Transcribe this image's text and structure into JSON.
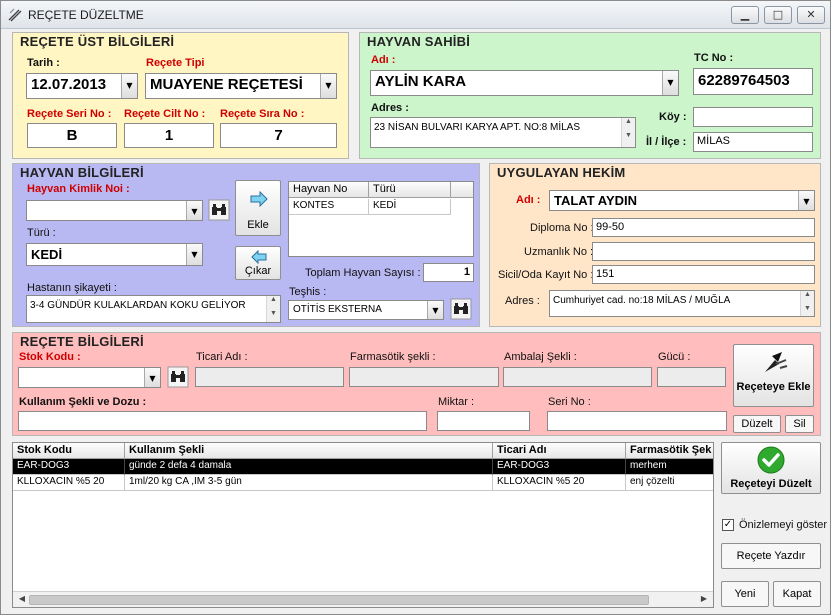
{
  "window": {
    "title": "REÇETE DÜZELTME",
    "minimize": "▁",
    "maximize": "□",
    "close": "✕"
  },
  "colors": {
    "yellow": "#fff6c4",
    "green": "#ccf5cc",
    "blue": "#b8b8f2",
    "orange": "#ffe6c9",
    "pink": "#ffbdbd",
    "label_red": "#d00000"
  },
  "recete_ust": {
    "title": "REÇETE ÜST BİLGİLERİ",
    "tarih_label": "Tarih :",
    "tarih": "12.07.2013",
    "tip_label": "Reçete Tipi",
    "tip": "MUAYENE REÇETESİ",
    "seri_label": "Reçete Seri No :",
    "seri": "B",
    "cilt_label": "Reçete Cilt No :",
    "cilt": "1",
    "sira_label": "Reçete Sıra No :",
    "sira": "7"
  },
  "hayvan_sahibi": {
    "title": "HAYVAN SAHİBİ",
    "adi_label": "Adı :",
    "adi": "AYLİN KARA",
    "tc_label": "TC No :",
    "tc": "62289764503",
    "adres_label": "Adres :",
    "adres": "23 NİSAN BULVARI KARYA APT. NO:8 MİLAS",
    "koy_label": "Köy :",
    "koy": "",
    "il_label": "İl / İlçe :",
    "il": "MİLAS"
  },
  "hayvan_bilgileri": {
    "title": "HAYVAN BİLGİLERİ",
    "kimlik_label": "Hayvan Kimlik Noi :",
    "kimlik": "",
    "turu_label": "Türü :",
    "turu": "KEDİ",
    "sikayet_label": "Hastanın şikayeti :",
    "sikayet": "3-4 GÜNDÜR KULAKLARDAN KOKU GELİYOR",
    "teshis_label": "Teşhis :",
    "teshis": "OTİTİS EKSTERNA",
    "ekle": "Ekle",
    "cikar": "Çıkar",
    "table_headers": [
      "Hayvan No",
      "Türü"
    ],
    "rows": [
      {
        "no": "KONTES",
        "turu": "KEDİ"
      }
    ],
    "toplam_label": "Toplam Hayvan Sayısı :",
    "toplam": "1"
  },
  "uygulayan_hekim": {
    "title": "UYGULAYAN HEKİM",
    "adi_label": "Adı :",
    "adi": "TALAT AYDIN",
    "diploma_label": "Diploma No :",
    "diploma": "99-50",
    "uzmanlik_label": "Uzmanlık No :",
    "uzmanlik": "",
    "sicil_label": "Sicil/Oda Kayıt No :",
    "sicil": "151",
    "adres_label": "Adres :",
    "adres": "Cumhuriyet cad. no:18 MİLAS / MUĞLA"
  },
  "recete_bilgileri": {
    "title": "REÇETE BİLGİLERİ",
    "stok_label": "Stok Kodu :",
    "ticari_label": "Ticari Adı :",
    "farma_label": "Farmasötik şekli :",
    "ambalaj_label": "Ambalaj Şekli :",
    "gucu_label": "Gücü :",
    "kullanim_label": "Kullanım Şekli ve Dozu :",
    "miktar_label": "Miktar :",
    "seri_label": "Seri No :",
    "recete_ekle": "Reçeteye Ekle",
    "duzelt": "Düzelt",
    "sil": "Sil"
  },
  "ilac_grid": {
    "headers": [
      "Stok Kodu",
      "Kullanım Şekli",
      "Ticari Adı",
      "Farmasötik Şek"
    ],
    "rows": [
      {
        "stok": "EAR-DOG3",
        "kullanim": "günde 2 defa 4 damala",
        "ticari": "EAR-DOG3",
        "farma": "merhem"
      },
      {
        "stok": "KLLOXACIN %5 20",
        "kullanim": "1ml/20 kg CA ,IM 3-5 gün",
        "ticari": "KLLOXACIN %5 20",
        "farma": "enj çözelti"
      }
    ]
  },
  "actions": {
    "receteyi_duzelt": "Reçeteyi Düzelt",
    "onizleme": "Önizlemeyi göster",
    "onizleme_checked": true,
    "recete_yazdir": "Reçete Yazdır",
    "yeni": "Yeni",
    "kapat": "Kapat"
  }
}
